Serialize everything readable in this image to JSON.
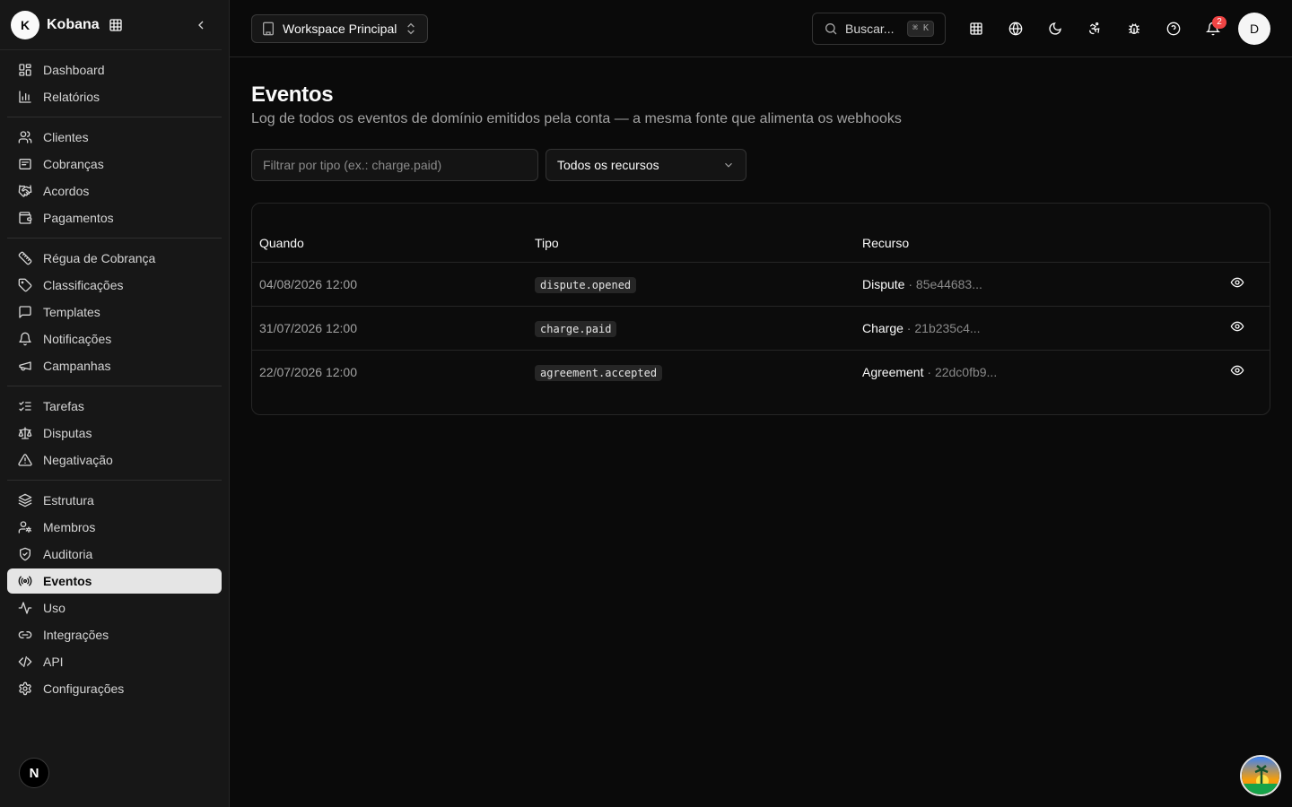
{
  "sidebar": {
    "brand_initial": "K",
    "brand_name": "Kobana",
    "groups": [
      [
        {
          "label": "Dashboard",
          "icon": "dashboard-icon"
        },
        {
          "label": "Relatórios",
          "icon": "bar-chart-icon"
        }
      ],
      [
        {
          "label": "Clientes",
          "icon": "users-icon"
        },
        {
          "label": "Cobranças",
          "icon": "receipt-icon"
        },
        {
          "label": "Acordos",
          "icon": "handshake-icon"
        },
        {
          "label": "Pagamentos",
          "icon": "wallet-icon"
        }
      ],
      [
        {
          "label": "Régua de Cobrança",
          "icon": "ruler-icon"
        },
        {
          "label": "Classificações",
          "icon": "tag-icon"
        },
        {
          "label": "Templates",
          "icon": "message-square-icon"
        },
        {
          "label": "Notificações",
          "icon": "bell-icon"
        },
        {
          "label": "Campanhas",
          "icon": "megaphone-icon"
        }
      ],
      [
        {
          "label": "Tarefas",
          "icon": "list-checks-icon"
        },
        {
          "label": "Disputas",
          "icon": "scale-icon"
        },
        {
          "label": "Negativação",
          "icon": "alert-triangle-icon"
        }
      ],
      [
        {
          "label": "Estrutura",
          "icon": "layers-icon"
        },
        {
          "label": "Membros",
          "icon": "user-cog-icon"
        },
        {
          "label": "Auditoria",
          "icon": "shield-check-icon"
        },
        {
          "label": "Eventos",
          "icon": "radio-icon",
          "active": true
        },
        {
          "label": "Uso",
          "icon": "activity-icon"
        },
        {
          "label": "Integrações",
          "icon": "link-icon"
        },
        {
          "label": "API",
          "icon": "code-icon"
        },
        {
          "label": "Configurações",
          "icon": "settings-icon"
        }
      ]
    ],
    "footer_badge": "N"
  },
  "topbar": {
    "workspace_label": "Workspace Principal",
    "search_label": "Buscar...",
    "search_shortcut": "⌘ K",
    "notification_count": "2",
    "user_initial": "D"
  },
  "main": {
    "title": "Eventos",
    "subtitle": "Log de todos os eventos de domínio emitidos pela conta — a mesma fonte que alimenta os webhooks",
    "filter_placeholder": "Filtrar por tipo (ex.: charge.paid)",
    "resource_select": "Todos os recursos",
    "table": {
      "headers": {
        "when": "Quando",
        "type": "Tipo",
        "resource": "Recurso"
      },
      "rows": [
        {
          "when": "04/08/2026 12:00",
          "type": "dispute.opened",
          "resource": "Dispute",
          "resource_sep": " · ",
          "resource_id": "85e44683..."
        },
        {
          "when": "31/07/2026 12:00",
          "type": "charge.paid",
          "resource": "Charge",
          "resource_sep": " · ",
          "resource_id": "21b235c4..."
        },
        {
          "when": "22/07/2026 12:00",
          "type": "agreement.accepted",
          "resource": "Agreement",
          "resource_sep": " · ",
          "resource_id": "22dc0fb9..."
        }
      ]
    }
  }
}
